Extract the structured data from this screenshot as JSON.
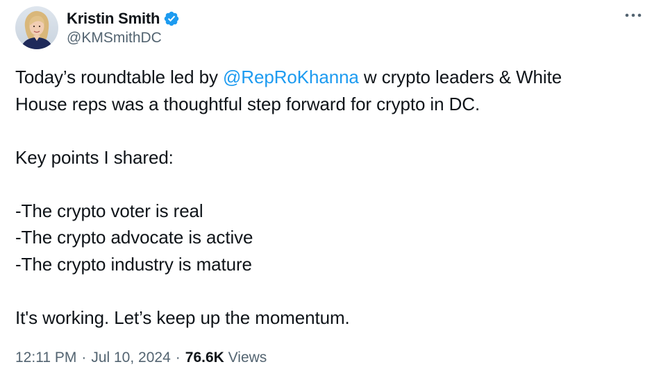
{
  "author": {
    "name": "Kristin Smith",
    "handle": "@KMSmithDC",
    "verified": true,
    "verified_color": "#1d9bf0",
    "avatar_icon": "profile-photo"
  },
  "more_icon": "ellipsis-icon",
  "tweet": {
    "line1_before": "Today’s roundtable led by ",
    "mention": "@RepRoKhanna",
    "line1_after": " w crypto leaders & White",
    "line2": "House reps was a thoughtful step forward for crypto in DC.",
    "line3": "",
    "line4": "Key points I shared:",
    "line5": "",
    "line6": "-The crypto voter is real",
    "line7": "-The crypto advocate is active",
    "line8": "-The crypto industry is mature",
    "line9": "",
    "line10": "It's working. Let’s keep up the momentum."
  },
  "meta": {
    "time": "12:11 PM",
    "date": "Jul 10, 2024",
    "separator": "·",
    "views_count": "76.6K",
    "views_label": "Views"
  },
  "colors": {
    "text": "#0f1419",
    "secondary": "#536471",
    "link": "#1d9bf0",
    "background": "#ffffff"
  }
}
